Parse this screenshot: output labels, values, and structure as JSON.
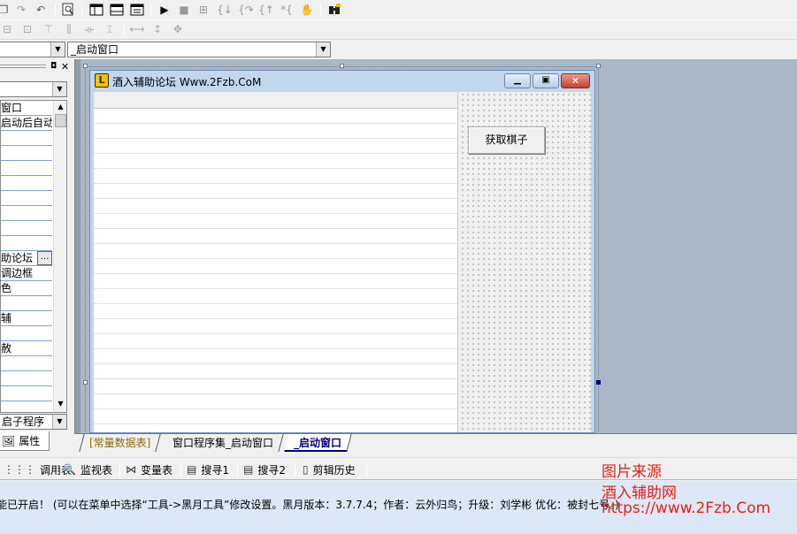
{
  "toolbar1": {
    "icons": [
      "copy-icon",
      "redo-icon",
      "undo-icon",
      "find-icon",
      "layout-a-icon",
      "layout-b-icon",
      "layout-c-icon",
      "run-icon",
      "stop-icon",
      "debug-icon",
      "step-into-icon",
      "step-over-icon",
      "step-out-icon",
      "run-to-cursor-icon",
      "hand-icon",
      "binoculars-icon"
    ]
  },
  "combos": {
    "left_value": "",
    "right_value": "_启动窗口"
  },
  "properties": {
    "dropdown_value": "",
    "rows": [
      "窗口",
      "启动后自动",
      "",
      "",
      "",
      "",
      "",
      "",
      "",
      "",
      "助论坛",
      "调边框",
      "色",
      "",
      "辅",
      "",
      "赦",
      "",
      "",
      ""
    ],
    "event_value": "启子程序",
    "tab_label": "属性"
  },
  "form": {
    "title": "酒入辅助论坛 Www.2Fzb.CoM",
    "button_label": "获取棋子"
  },
  "editor_tabs": [
    {
      "label": "[常量数据表]",
      "color": "#8c6a00",
      "bold": false
    },
    {
      "label": "窗口程序集_启动窗口",
      "color": "#000000",
      "bold": false
    },
    {
      "label": "_启动窗口",
      "color": "#000080",
      "bold": true
    }
  ],
  "bottom_tabs": [
    {
      "label": "调用表",
      "icon": "call-table-icon",
      "glyph": "⋮⋮⋮"
    },
    {
      "label": "监视表",
      "icon": "magnifier-icon",
      "glyph": "🔍"
    },
    {
      "label": "变量表",
      "icon": "variable-icon",
      "glyph": "⋈"
    },
    {
      "label": "搜寻1",
      "icon": "search-list-icon",
      "glyph": "▤"
    },
    {
      "label": "搜寻2",
      "icon": "search-list-icon",
      "glyph": "▤"
    },
    {
      "label": "剪辑历史",
      "icon": "clip-history-icon",
      "glyph": "▯"
    }
  ],
  "status_text": "能已开启！  (可以在菜单中选择“工具->黑月工具”修改设置。黑月版本：3.7.7.4；作者：云外归鸟；升级：刘学彬 优化：被封七号。)",
  "watermark": {
    "line1": "图片来源",
    "line2": "酒入辅助网",
    "line3": "https://www.2Fzb.Com"
  },
  "colors": {
    "workspace": "#aab7c7",
    "form_face": "#f0f0f0",
    "title_active": "#c2d6ec",
    "close_red": "#d04a3c",
    "link_blue": "#7fa2d8",
    "watermark": "#e8201a"
  }
}
